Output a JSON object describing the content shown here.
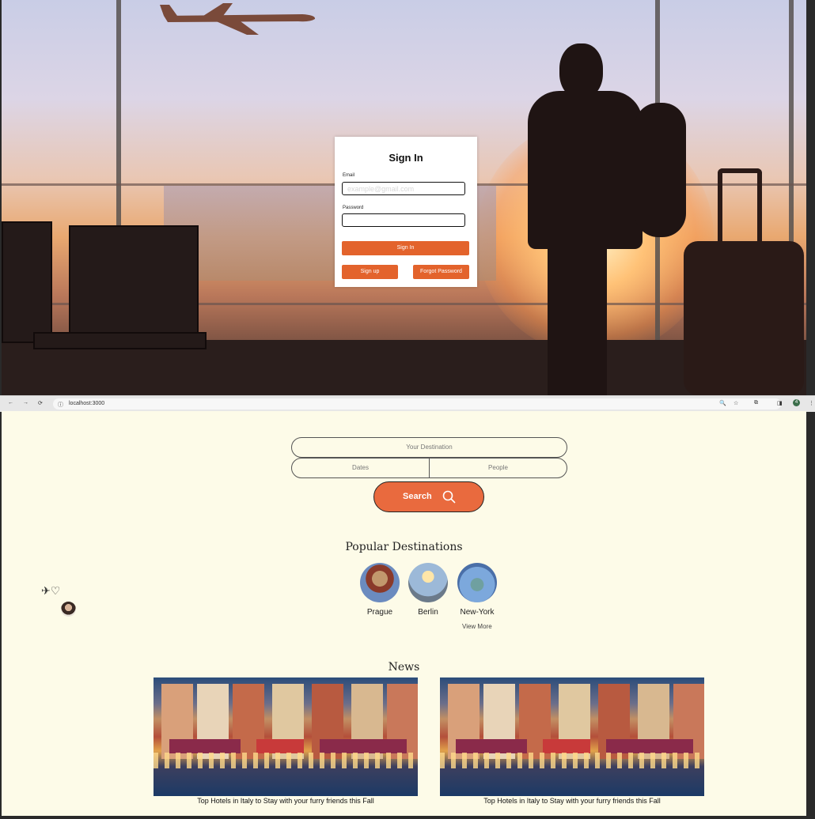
{
  "signin": {
    "title": "Sign In",
    "email_label": "Email",
    "email_placeholder": "example@gmail.com",
    "password_label": "Password",
    "password_value": "",
    "signin_button": "Sign In",
    "signup_button": "Sign up",
    "forgot_button": "Forgot Password"
  },
  "browser": {
    "url": "localhost:3000",
    "extension_badge": "4"
  },
  "search": {
    "destination_placeholder": "Your Destination",
    "dates_placeholder": "Dates",
    "people_placeholder": "People",
    "button_label": "Search"
  },
  "floating": {
    "logo_text": "✈♡"
  },
  "popular": {
    "heading": "Popular Destinations",
    "items": [
      {
        "name": "Prague"
      },
      {
        "name": "Berlin"
      },
      {
        "name": "New-York"
      }
    ],
    "view_more": "View More"
  },
  "news": {
    "heading": "News",
    "items": [
      {
        "caption": "Top Hotels in Italy to Stay with your furry friends this Fall"
      },
      {
        "caption": "Top Hotels in Italy to Stay with your furry friends this Fall"
      }
    ]
  },
  "colors": {
    "accent": "#e3632c",
    "search_button": "#e96a3e",
    "page_background": "#fdfbe8"
  }
}
